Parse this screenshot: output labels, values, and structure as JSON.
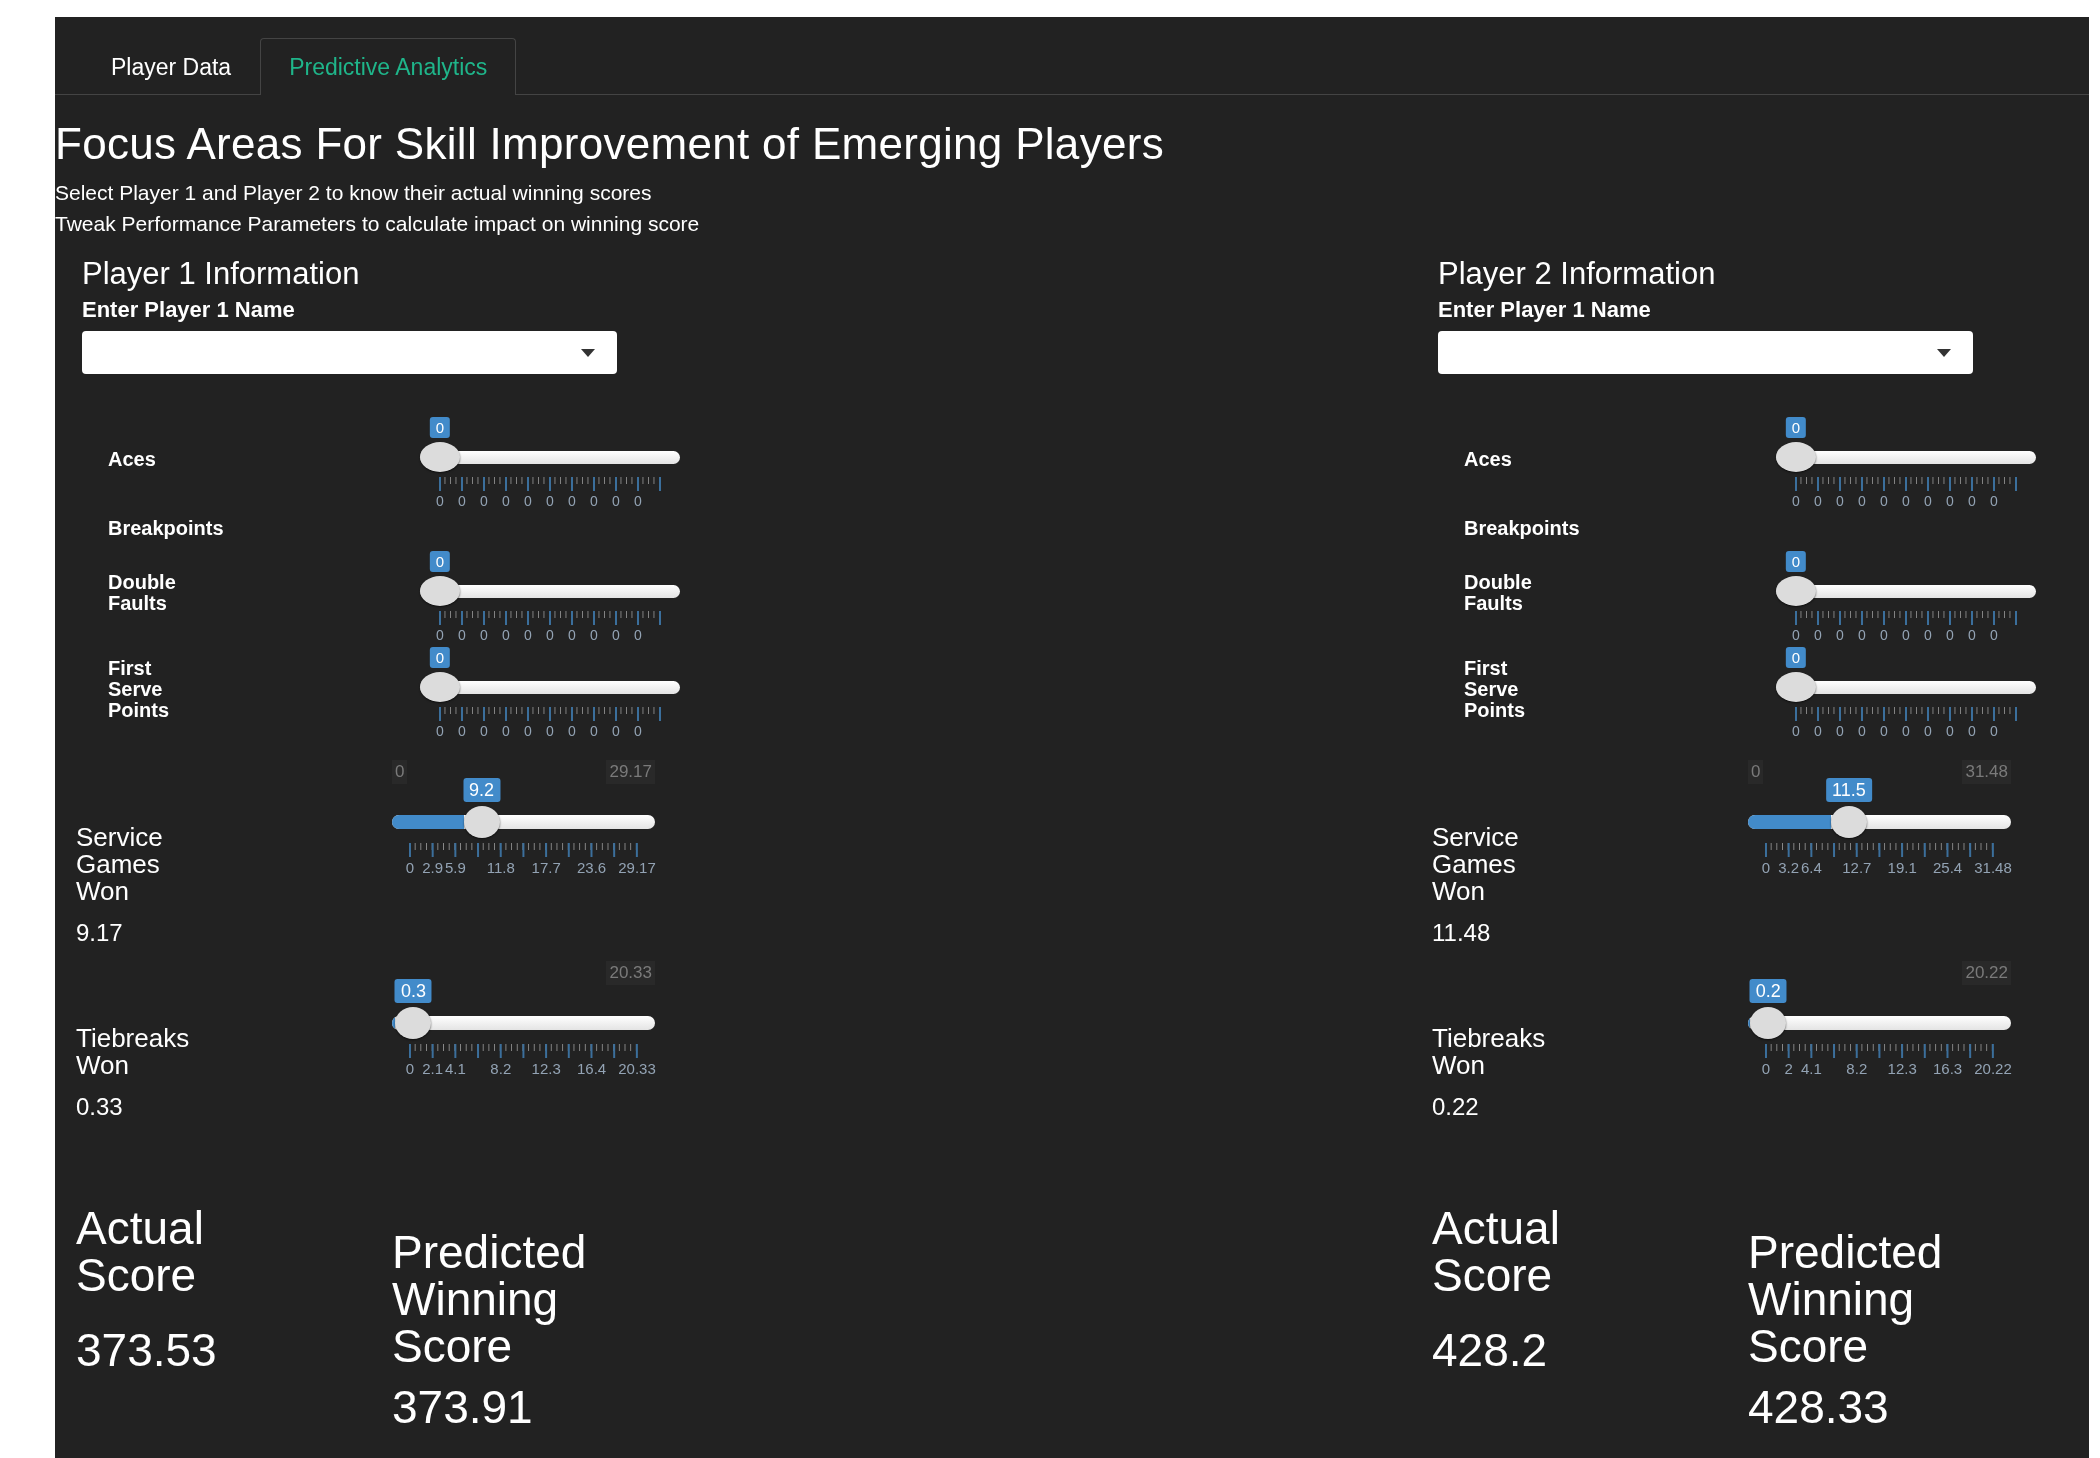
{
  "tabs": [
    {
      "label": "Player Data",
      "selected": false
    },
    {
      "label": "Predictive Analytics",
      "selected": true
    }
  ],
  "title": "Focus Areas For Skill Improvement of Emerging Players",
  "instructions": [
    "Select Player 1 and Player 2 to know their actual winning scores",
    "Tweak Performance Parameters to calculate impact on winning score"
  ],
  "players": [
    {
      "heading": "Player 1 Information",
      "name_label": "Enter Player 1 Name",
      "parameters": [
        {
          "kind": "zero_slider",
          "label": "Aces",
          "badge": "0",
          "level": 0,
          "tick_labels": [
            "0",
            "0",
            "0",
            "0",
            "0",
            "0",
            "0",
            "0",
            "0",
            "0"
          ]
        },
        {
          "kind": "label",
          "label": "Breakpoints"
        },
        {
          "kind": "zero_slider",
          "label": "Double Faults",
          "badge": "0",
          "level": 0,
          "tick_labels": [
            "0",
            "0",
            "0",
            "0",
            "0",
            "0",
            "0",
            "0",
            "0",
            "0"
          ]
        },
        {
          "kind": "zero_slider",
          "label": "First Serve Points",
          "badge": "0",
          "level": 0,
          "tick_labels": [
            "0",
            "0",
            "0",
            "0",
            "0",
            "0",
            "0",
            "0",
            "0",
            "0"
          ]
        },
        {
          "kind": "range_slider",
          "label": "Service Games Won",
          "badge": "9.2",
          "level": 0.315,
          "min_label": "0",
          "max_label": "29.17",
          "tick_labels": [
            "0",
            "2.9",
            "5.9",
            "11.8",
            "17.7",
            "23.6",
            "29.17"
          ],
          "value": "9.17"
        },
        {
          "kind": "range_slider",
          "label": "Tiebreaks Won",
          "badge": "0.3",
          "level": 0.015,
          "max_label": "20.33",
          "tick_labels": [
            "0",
            "2.1",
            "4.1",
            "8.2",
            "12.3",
            "16.4",
            "20.33"
          ],
          "value": "0.33"
        }
      ],
      "actual_score": {
        "label": "Actual Score",
        "value": "373.53"
      },
      "predicted_score": {
        "label": "Predicted Winning Score",
        "value": "373.91"
      }
    },
    {
      "heading": "Player 2 Information",
      "name_label": "Enter Player 1 Name",
      "parameters": [
        {
          "kind": "zero_slider",
          "label": "Aces",
          "badge": "0",
          "level": 0,
          "tick_labels": [
            "0",
            "0",
            "0",
            "0",
            "0",
            "0",
            "0",
            "0",
            "0",
            "0"
          ]
        },
        {
          "kind": "label",
          "label": "Breakpoints"
        },
        {
          "kind": "zero_slider",
          "label": "Double Faults",
          "badge": "0",
          "level": 0,
          "tick_labels": [
            "0",
            "0",
            "0",
            "0",
            "0",
            "0",
            "0",
            "0",
            "0",
            "0"
          ]
        },
        {
          "kind": "zero_slider",
          "label": "First Serve Points",
          "badge": "0",
          "level": 0,
          "tick_labels": [
            "0",
            "0",
            "0",
            "0",
            "0",
            "0",
            "0",
            "0",
            "0",
            "0"
          ]
        },
        {
          "kind": "range_slider",
          "label": "Service Games Won",
          "badge": "11.5",
          "level": 0.365,
          "min_label": "0",
          "max_label": "31.48",
          "tick_labels": [
            "0",
            "3.2",
            "6.4",
            "12.7",
            "19.1",
            "25.4",
            "31.48"
          ],
          "value": "11.48"
        },
        {
          "kind": "range_slider",
          "label": "Tiebreaks Won",
          "badge": "0.2",
          "level": 0.01,
          "max_label": "20.22",
          "tick_labels": [
            "0",
            "2",
            "4.1",
            "8.2",
            "12.3",
            "16.3",
            "20.22"
          ],
          "value": "0.22"
        }
      ],
      "actual_score": {
        "label": "Actual Score",
        "value": "428.2"
      },
      "predicted_score": {
        "label": "Predicted Winning Score",
        "value": "428.33"
      }
    }
  ]
}
